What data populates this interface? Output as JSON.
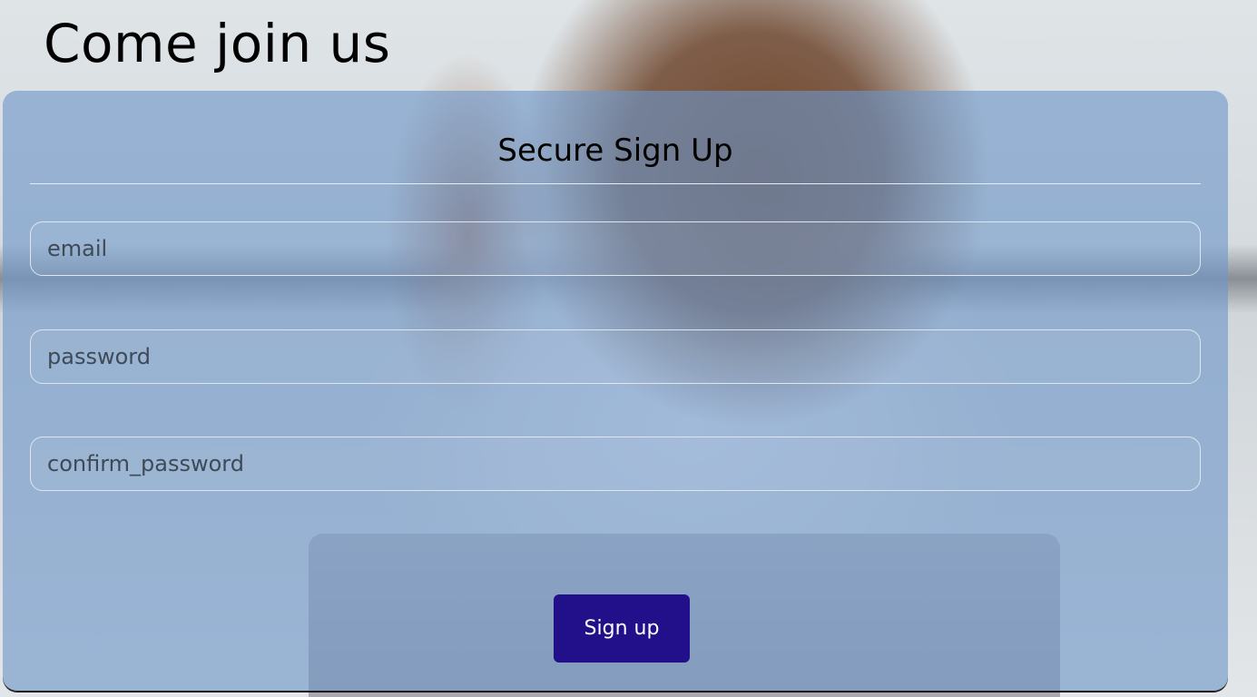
{
  "header": {
    "title": "Come join us"
  },
  "signup_card": {
    "title": "Secure Sign Up",
    "fields": {
      "email_placeholder": "email",
      "password_placeholder": "password",
      "confirm_password_placeholder": "confirm_password"
    },
    "submit_label": "Sign up"
  },
  "colors": {
    "button_background": "#22108a",
    "button_text": "#ffffff",
    "card_overlay": "rgba(110, 150, 200, 0.62)"
  }
}
